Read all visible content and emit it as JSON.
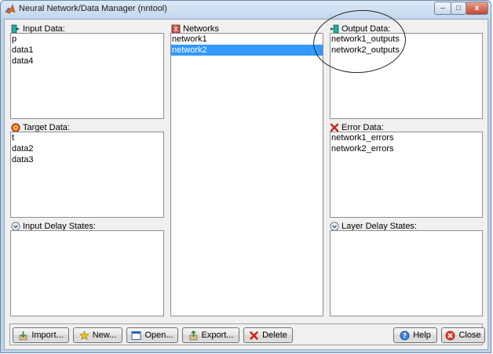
{
  "window": {
    "title": "Neural Network/Data Manager (nntool)",
    "controls": {
      "minimize": "–",
      "maximize": "□",
      "close": "x"
    }
  },
  "panels": {
    "input_data": {
      "label": "Input Data:",
      "items": [
        "p",
        "data1",
        "data4"
      ]
    },
    "networks": {
      "label": "Networks",
      "items": [
        "network1",
        "network2"
      ],
      "selected_index": 1
    },
    "output_data": {
      "label": "Output Data:",
      "items": [
        "network1_outputs",
        "network2_outputs"
      ]
    },
    "target_data": {
      "label": "Target Data:",
      "items": [
        "t",
        "data2",
        "data3"
      ]
    },
    "error_data": {
      "label": "Error Data:",
      "items": [
        "network1_errors",
        "network2_errors"
      ]
    },
    "input_delay_states": {
      "label": "Input Delay States:",
      "items": []
    },
    "layer_delay_states": {
      "label": "Layer Delay States:",
      "items": []
    }
  },
  "buttons": {
    "import": "Import...",
    "new": "New...",
    "open": "Open...",
    "export": "Export...",
    "delete": "Delete",
    "help": "Help",
    "close": "Close"
  },
  "colors": {
    "selection": "#3399ff",
    "frame": "#bcd3ea",
    "client": "#f0f0f0"
  }
}
